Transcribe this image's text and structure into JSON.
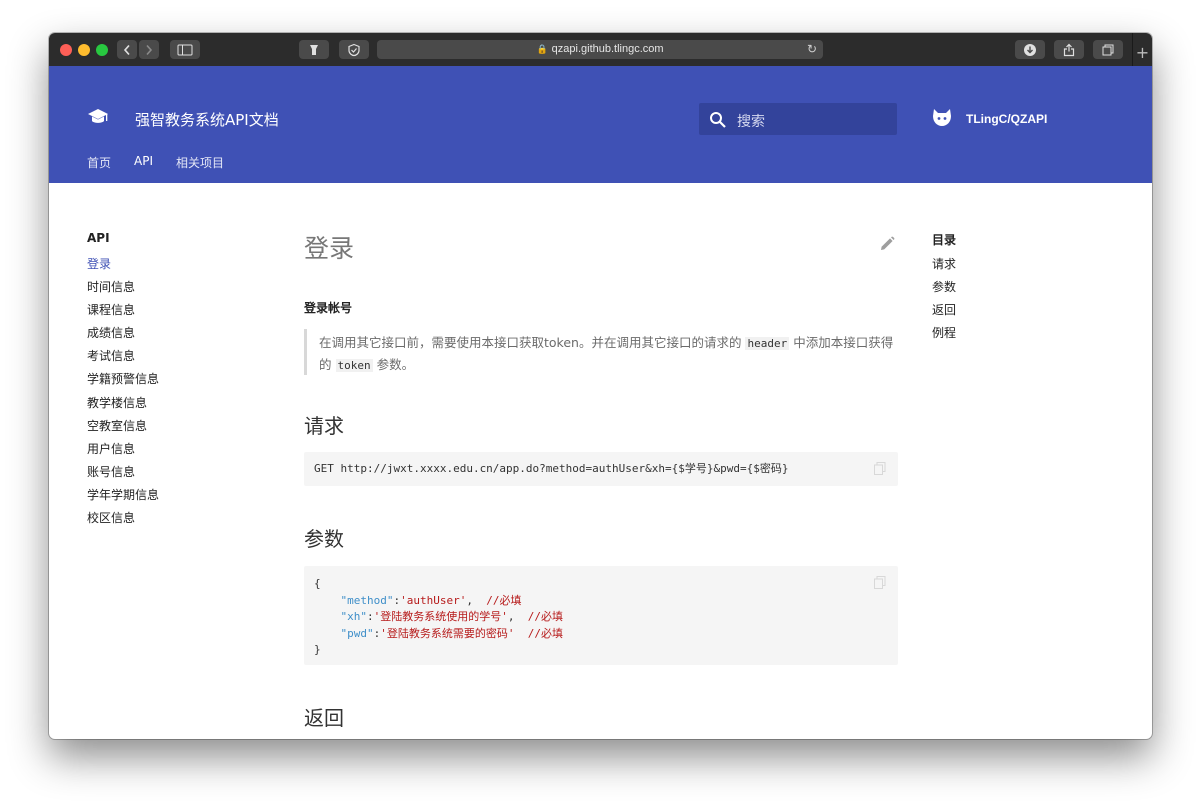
{
  "browser": {
    "url": "qzapi.github.tlingc.com"
  },
  "site": {
    "title": "强智教务系统API文档",
    "search_placeholder": "搜索",
    "repo": "TLingC/QZAPI",
    "tabs": [
      "首页",
      "API",
      "相关项目"
    ],
    "active_tab": "API",
    "header_color": "#3f51b5"
  },
  "nav": {
    "title": "API",
    "items": [
      "登录",
      "时间信息",
      "课程信息",
      "成绩信息",
      "考试信息",
      "学籍预警信息",
      "教学楼信息",
      "空教室信息",
      "用户信息",
      "账号信息",
      "学年学期信息",
      "校区信息"
    ],
    "active": "登录"
  },
  "article": {
    "title": "登录",
    "subtitle": "登录帐号",
    "quote": {
      "part1": "在调用其它接口前，需要使用本接口获取token。并在调用其它接口的请求的",
      "code1": "header",
      "part2": "中添加本接口获得的",
      "code2": "token",
      "part3": "参数。"
    },
    "sections": {
      "request": "请求",
      "params": "参数",
      "returns": "返回"
    },
    "request_code": "GET http://jwxt.xxxx.edu.cn/app.do?method=authUser&xh={$学号}&pwd={$密码}",
    "params_code": {
      "open": "{",
      "lines": [
        {
          "key": "\"method\"",
          "value": "'authUser'",
          "comment": "//必填"
        },
        {
          "key": "\"xh\"",
          "value": "'登陆教务系统使用的学号'",
          "comment": "//必填"
        },
        {
          "key": "\"pwd\"",
          "value": "'登陆教务系统需要的密码'",
          "comment": "//必填"
        }
      ],
      "close": "}"
    },
    "returns_code": "{"
  },
  "toc": {
    "title": "目录",
    "items": [
      "请求",
      "参数",
      "返回",
      "例程"
    ]
  }
}
